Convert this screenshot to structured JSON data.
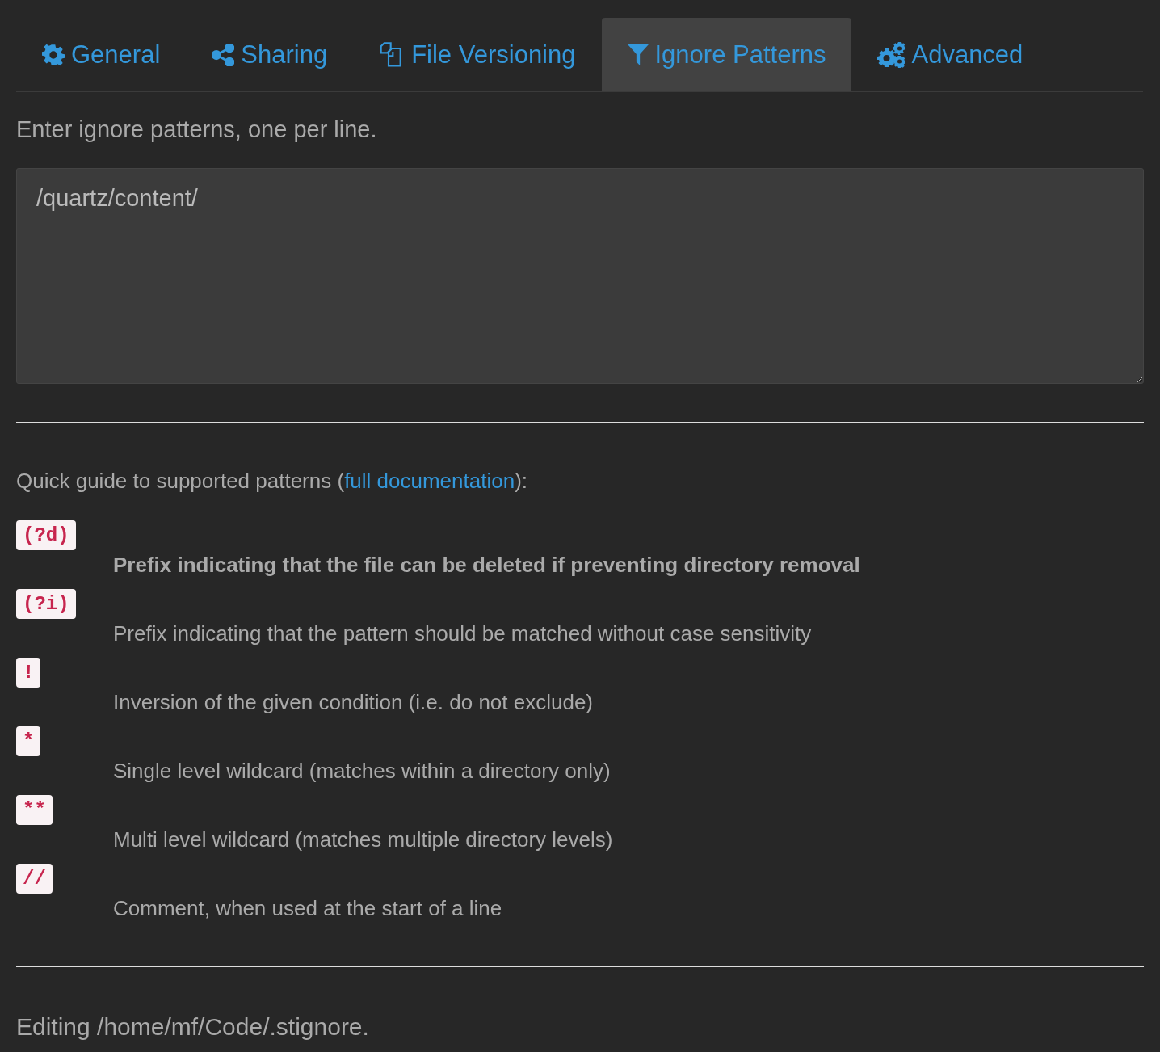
{
  "tabs": [
    {
      "label": "General",
      "kind": "gear",
      "selected": false
    },
    {
      "label": "Sharing",
      "kind": "share",
      "selected": false
    },
    {
      "label": "File Versioning",
      "kind": "copy",
      "selected": false
    },
    {
      "label": "Ignore Patterns",
      "kind": "filter",
      "selected": true
    },
    {
      "label": "Advanced",
      "kind": "gears",
      "selected": false
    }
  ],
  "intro": "Enter ignore patterns, one per line.",
  "patterns_field": {
    "value": "/quartz/content/"
  },
  "guide": {
    "before": "Quick guide to supported patterns (",
    "link": "full documentation",
    "after": "):"
  },
  "patterns": [
    {
      "code": "(?d)",
      "description": "Prefix indicating that the file can be deleted if preventing directory removal",
      "bold": true
    },
    {
      "code": "(?i)",
      "description": "Prefix indicating that the pattern should be matched without case sensitivity",
      "bold": false
    },
    {
      "code": "!",
      "description": "Inversion of the given condition (i.e. do not exclude)",
      "bold": false
    },
    {
      "code": "*",
      "description": "Single level wildcard (matches within a directory only)",
      "bold": false
    },
    {
      "code": "**",
      "description": "Multi level wildcard (matches multiple directory levels)",
      "bold": false
    },
    {
      "code": "//",
      "description": "Comment, when used at the start of a line",
      "bold": false
    }
  ],
  "footer": "Editing /home/mf/Code/.stignore."
}
